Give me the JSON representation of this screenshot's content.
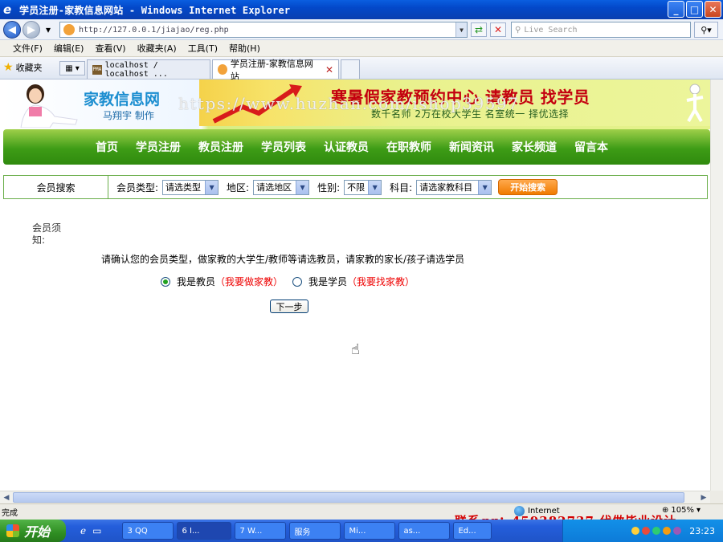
{
  "window": {
    "title": "学员注册-家教信息网站 - Windows Internet Explorer",
    "minimize": "_",
    "maximize": "□",
    "close": "✕"
  },
  "addressbar": {
    "url": "http://127.0.0.1/jiajao/reg.php",
    "search_placeholder": "Live Search"
  },
  "menu": [
    "文件(F)",
    "编辑(E)",
    "查看(V)",
    "收藏夹(A)",
    "工具(T)",
    "帮助(H)"
  ],
  "favorites_label": "收藏夹",
  "tabs": [
    {
      "label": "localhost / localhost ...",
      "active": false
    },
    {
      "label": "学员注册-家教信息网站",
      "active": true
    }
  ],
  "site": {
    "name": "家教信息网",
    "author": "马翔宇 制作",
    "banner_title": "寒暑假家教预约中心 请教员 找学员",
    "banner_sub": "数千名师 2万在校大学生 名室统一 择优选择",
    "watermark": "https://www.huzhan.com/ishop39597"
  },
  "nav": [
    "首页",
    "学员注册",
    "教员注册",
    "学员列表",
    "认证教员",
    "在职教师",
    "新闻资讯",
    "家长频道",
    "留言本"
  ],
  "search": {
    "label": "会员搜索",
    "member_type_label": "会员类型:",
    "member_type_value": "请选类型",
    "region_label": "地区:",
    "region_value": "请选地区",
    "gender_label": "性别:",
    "gender_value": "不限",
    "subject_label": "科目:",
    "subject_value": "请选家教科目",
    "button": "开始搜索"
  },
  "notice": {
    "title": "会员须知:",
    "text": "请确认您的会员类型，做家教的大学生/教师等请选教员，请家教的家长/孩子请选学员",
    "option_teacher": "我是教员",
    "option_teacher_hint": "（我要做家教）",
    "option_student": "我是学员",
    "option_student_hint": "（我要找家教）",
    "next_button": "下一步"
  },
  "statusbar": {
    "text": "完成",
    "zone": "Internet",
    "zoom": "105%"
  },
  "overlay_watermark": "联系qq：459382737 代做毕业设计",
  "taskbar": {
    "start": "开始",
    "tasks": [
      "3 QQ",
      "6 I...",
      "7 W...",
      "服务",
      "Mi...",
      "as...",
      "Ed..."
    ],
    "clock": "23:23"
  },
  "colors": {
    "nav_green": "#3e9c16",
    "accent_red": "#e00000",
    "search_button": "#f07b00"
  }
}
